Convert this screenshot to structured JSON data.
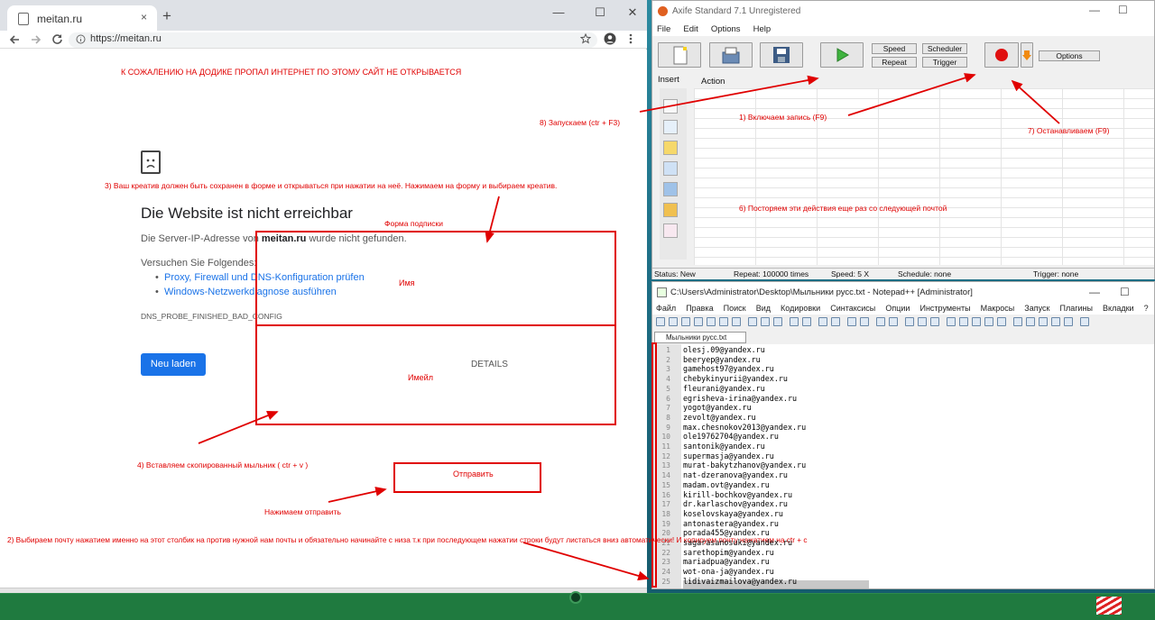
{
  "chrome": {
    "tab_title": "meitan.ru",
    "tab_close": "×",
    "new_tab": "+",
    "url": "https://meitan.ru",
    "win_min": "—",
    "win_max": "☐",
    "win_close": "✕"
  },
  "error_page": {
    "title": "Die Website ist nicht erreichbar",
    "line1_pre": "Die Server-IP-Adresse von",
    "line1_host": "meitan.ru",
    "line1_post": "wurde nicht gefunden.",
    "try_label": "Versuchen Sie Folgendes:",
    "suggestions": [
      "Proxy, Firewall und DNS-Konfiguration prüfen",
      "Windows-Netzwerkdiagnose ausführen"
    ],
    "error_code": "DNS_PROBE_FINISHED_BAD_CONFIG",
    "reload_label": "Neu laden",
    "details_label": "DETAILS"
  },
  "annotations": {
    "top_notice": "К СОЖАЛЕНИЮ НА ДОДИКЕ ПРОПАЛ ИНТЕРНЕТ ПО ЭТОМУ САЙТ НЕ ОТКРЫВАЕТСЯ",
    "step8": "8) Запускаем (ctr + F3)",
    "step1": "1) Включаем запись (F9)",
    "step7": "7) Останавливаем (F9)",
    "step6": "6) Посторяем эти действия еще раз со следующей почтой",
    "step3": "3) Ваш креатив должен быть сохранен в форме и открываться при нажатии на неё. Нажимаем на форму и выбираем креатив.",
    "form_label": "Форма подписки",
    "name_label": "Имя",
    "email_label": "Имейл",
    "step4": "4) Вставляем скопированный мыльник ( ctr + v )",
    "submit_label": "Отправить",
    "press_submit": "Нажимаем отправить",
    "step2": "2) Выбираем почту нажатием именно на этот столбик на против нужной нам почты и обязательно начинайте с низа т.к при последующем нажатии строки будут листаться вниз автоматически! И копируем почту нажатием на ctr + c"
  },
  "axife": {
    "title": "Axife Standard 7.1 Unregistered",
    "menu": [
      "File",
      "Edit",
      "Options",
      "Help"
    ],
    "speed_label": "Speed",
    "repeat_label": "Repeat",
    "scheduler_label": "Scheduler",
    "trigger_label": "Trigger",
    "options_label": "Options",
    "insert_tab": "Insert",
    "action_tab": "Action",
    "status": {
      "state": "Status: New",
      "repeat": "Repeat: 100000 times",
      "speed": "Speed: 5 X",
      "schedule": "Schedule: none",
      "trigger": "Trigger: none"
    }
  },
  "npp": {
    "title": "C:\\Users\\Administrator\\Desktop\\Мыльники русс.txt - Notepad++ [Administrator]",
    "menu": [
      "Файл",
      "Правка",
      "Поиск",
      "Вид",
      "Кодировки",
      "Синтаксисы",
      "Опции",
      "Инструменты",
      "Макросы",
      "Запуск",
      "Плагины",
      "Вкладки",
      "?"
    ],
    "tab": "Мыльники русс.txt",
    "lines": [
      "olesj.09@yandex.ru",
      "beeryep@yandex.ru",
      "gamehost97@yandex.ru",
      "chebykinyurii@yandex.ru",
      "fleurani@yandex.ru",
      "egrisheva-irina@yandex.ru",
      "yogot@yandex.ru",
      "zevolt@yandex.ru",
      "max.chesnokov2013@yandex.ru",
      "ole19762704@yandex.ru",
      "santonik@yandex.ru",
      "supermasja@yandex.ru",
      "murat-bakytzhanov@yandex.ru",
      "nat-dzeranova@yandex.ru",
      "madam.ovt@yandex.ru",
      "kirill-bochkov@yandex.ru",
      "dr.karlaschov@yandex.ru",
      "koselovskaya@yandex.ru",
      "antonastera@yandex.ru",
      "porada455@yandex.ru",
      "sagarasanosuki@yandex.ru",
      "sarethopim@yandex.ru",
      "mariadpua@yandex.ru",
      "wot-ona-ja@yandex.ru",
      "lidivaizmailova@yandex.ru"
    ]
  },
  "colors": {
    "annotation_red": "#e00000",
    "link_blue": "#1a73e8",
    "taskbar_green": "#1f7a3f"
  }
}
